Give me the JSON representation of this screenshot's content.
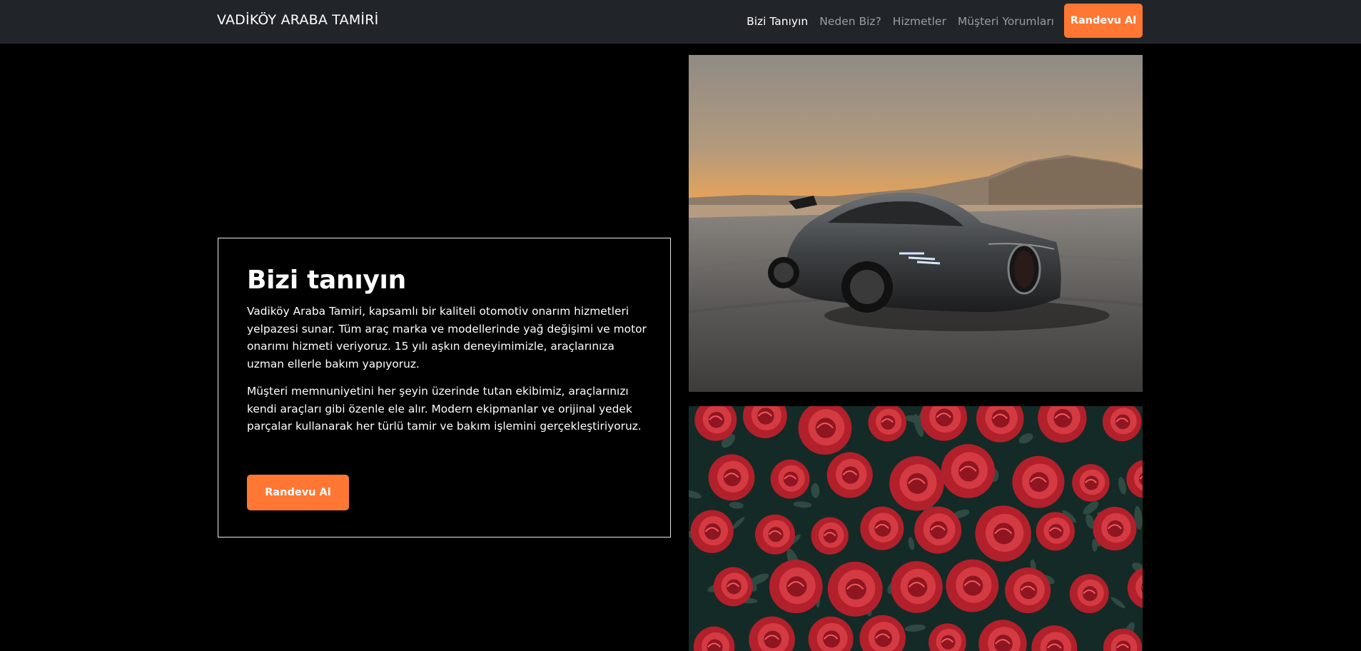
{
  "navbar": {
    "brand": "VADİKÖY ARABA TAMİRİ",
    "links": [
      {
        "label": "Bizi Tanıyın"
      },
      {
        "label": "Neden Biz?"
      },
      {
        "label": "Hizmetler"
      },
      {
        "label": "Müşteri Yorumları"
      }
    ],
    "cta_label": "Randevu Al"
  },
  "about": {
    "title": "Bizi tanıyın",
    "paragraph1": "Vadiköy Araba Tamiri, kapsamlı bir kaliteli otomotiv onarım hizmetleri yelpazesi sunar. Tüm araç marka ve modellerinde yağ değişimi ve motor onarımı hizmeti veriyoruz. 15 yılı aşkın deneyimimizle, araçlarınıza uzman ellerle bakım yapıyoruz.",
    "paragraph2": "Müşteri memnuniyetini her şeyin üzerinde tutan ekibimiz, araçlarınızı kendi araçları gibi özenle ele alır. Modern ekipmanlar ve orijinal yedek parçalar kullanarak her türlü tamir ve bakım işlemini gerçekleştiriyoruz.",
    "cta_label": "Randevu Al"
  },
  "colors": {
    "navbar_bg": "#212529",
    "accent": "#ff7733",
    "page_bg": "#000000"
  }
}
